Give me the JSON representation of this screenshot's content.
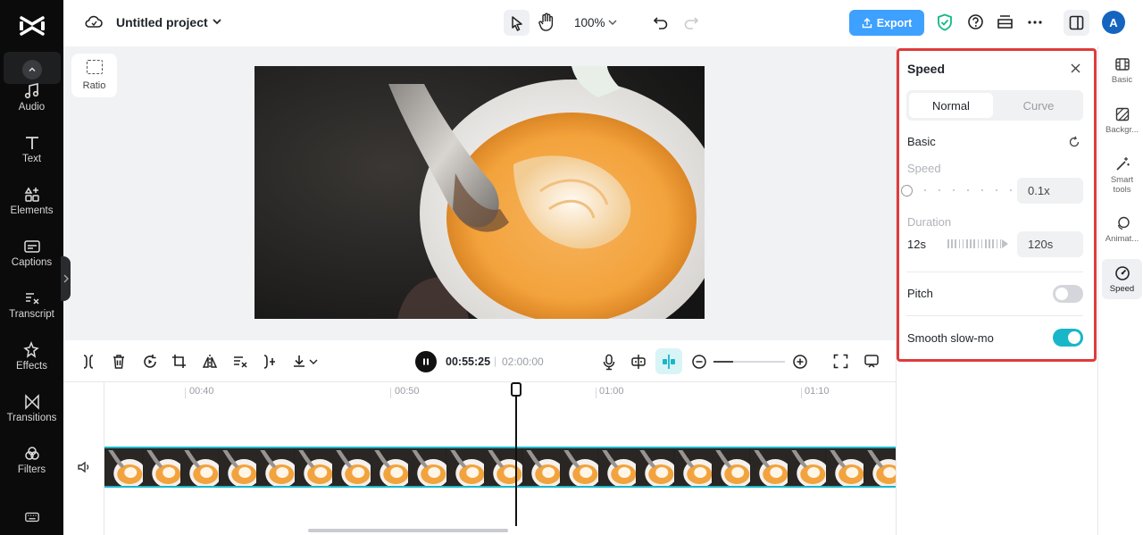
{
  "sidebar": {
    "items": [
      {
        "label": "Audio",
        "icon": "music-note-icon"
      },
      {
        "label": "Text",
        "icon": "text-icon"
      },
      {
        "label": "Elements",
        "icon": "elements-icon"
      },
      {
        "label": "Captions",
        "icon": "captions-icon"
      },
      {
        "label": "Transcript",
        "icon": "transcript-icon"
      },
      {
        "label": "Effects",
        "icon": "effects-icon"
      },
      {
        "label": "Transitions",
        "icon": "transitions-icon"
      },
      {
        "label": "Filters",
        "icon": "filters-icon"
      }
    ]
  },
  "topbar": {
    "project_title": "Untitled project",
    "zoom_level": "100%",
    "export_label": "Export",
    "avatar_initial": "A"
  },
  "canvas": {
    "ratio_label": "Ratio"
  },
  "playback": {
    "current_time": "00:55:25",
    "separator": "|",
    "total_time": "02:00:00"
  },
  "timeline": {
    "ticks": [
      "00:40",
      "00:50",
      "01:00",
      "01:10"
    ]
  },
  "speed_panel": {
    "title": "Speed",
    "tabs": [
      "Normal",
      "Curve"
    ],
    "active_tab": "Normal",
    "basic_label": "Basic",
    "speed_label": "Speed",
    "speed_value": "0.1x",
    "duration_label": "Duration",
    "duration_from": "12s",
    "duration_to": "120s",
    "pitch_label": "Pitch",
    "pitch_enabled": false,
    "smooth_label": "Smooth slow-mo",
    "smooth_enabled": true
  },
  "right_rail": {
    "items": [
      {
        "label": "Basic",
        "icon": "film-icon"
      },
      {
        "label": "Backgr...",
        "icon": "background-icon"
      },
      {
        "label": "Smart tools",
        "icon": "magic-wand-icon"
      },
      {
        "label": "Animat...",
        "icon": "animation-icon"
      },
      {
        "label": "Speed",
        "icon": "speedometer-icon"
      }
    ],
    "active": "Speed"
  },
  "colors": {
    "accent": "#19b6c9",
    "export": "#3ea0ff",
    "highlight": "#e03b3b",
    "sidebar_bg": "#0b0b0c"
  }
}
